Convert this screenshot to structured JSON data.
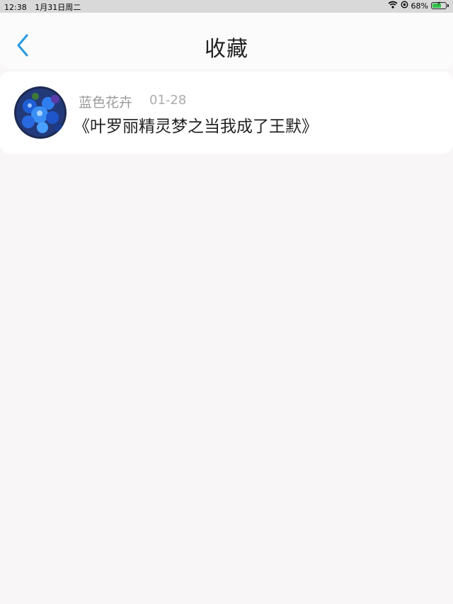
{
  "status_bar": {
    "time": "12:38",
    "date": "1月31日周二",
    "battery": "68%",
    "battery_level": 0.68
  },
  "nav": {
    "title": "收藏"
  },
  "favorites": [
    {
      "user": "蓝色花卉",
      "date": "01-28",
      "title": "《叶罗丽精灵梦之当我成了王默》"
    }
  ],
  "colors": {
    "accent": "#2f9be0",
    "background": "#f8f6f7",
    "status_bar": "#d9d9d9"
  },
  "icons": [
    "chevron-left-icon",
    "wifi-icon",
    "location-lock-icon",
    "battery-icon"
  ]
}
